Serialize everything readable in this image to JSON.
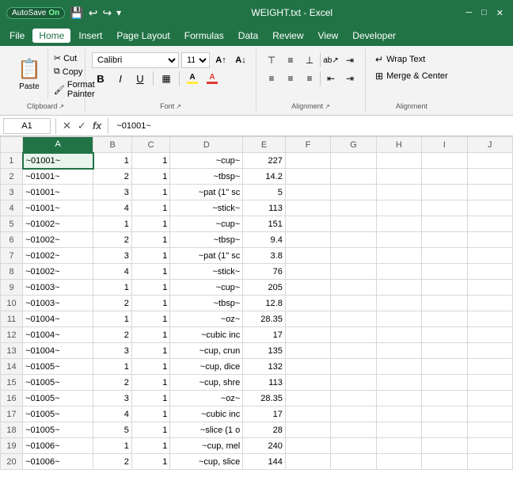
{
  "titleBar": {
    "autosave": "AutoSave",
    "autosave_state": "On",
    "title": "WEIGHT.txt  -  Excel"
  },
  "menuBar": {
    "items": [
      "File",
      "Home",
      "Insert",
      "Page Layout",
      "Formulas",
      "Data",
      "Review",
      "View",
      "Developer"
    ]
  },
  "ribbon": {
    "clipboard": {
      "label": "Clipboard",
      "paste": "Paste",
      "cut": "Cut",
      "copy": "Copy",
      "format_painter": "Format Painter"
    },
    "font": {
      "label": "Font",
      "name": "Calibri",
      "size": "11",
      "bold": "B",
      "italic": "I",
      "underline": "U",
      "border": "▦",
      "fill_color": "A",
      "font_color": "A"
    },
    "alignment": {
      "label": "Alignment"
    },
    "wrap": {
      "label": "Alignment",
      "wrap_text": "Wrap Text",
      "merge_center": "Merge & Center"
    }
  },
  "formulaBar": {
    "cell_ref": "A1",
    "formula": "~01001~"
  },
  "columns": {
    "headers": [
      "",
      "A",
      "B",
      "C",
      "D",
      "E",
      "F",
      "G",
      "H",
      "I",
      "J"
    ],
    "widths": [
      22,
      70,
      40,
      40,
      70,
      40,
      45,
      45,
      45,
      45,
      45
    ]
  },
  "rows": [
    {
      "num": 1,
      "A": "~01001~",
      "B": "1",
      "C": "1",
      "D": "~cup~",
      "E": "227"
    },
    {
      "num": 2,
      "A": "~01001~",
      "B": "2",
      "C": "1",
      "D": "~tbsp~",
      "E": "14.2"
    },
    {
      "num": 3,
      "A": "~01001~",
      "B": "3",
      "C": "1",
      "D": "~pat (1\" sc",
      "E": "5"
    },
    {
      "num": 4,
      "A": "~01001~",
      "B": "4",
      "C": "1",
      "D": "~stick~",
      "E": "113"
    },
    {
      "num": 5,
      "A": "~01002~",
      "B": "1",
      "C": "1",
      "D": "~cup~",
      "E": "151"
    },
    {
      "num": 6,
      "A": "~01002~",
      "B": "2",
      "C": "1",
      "D": "~tbsp~",
      "E": "9.4"
    },
    {
      "num": 7,
      "A": "~01002~",
      "B": "3",
      "C": "1",
      "D": "~pat (1\" sc",
      "E": "3.8"
    },
    {
      "num": 8,
      "A": "~01002~",
      "B": "4",
      "C": "1",
      "D": "~stick~",
      "E": "76"
    },
    {
      "num": 9,
      "A": "~01003~",
      "B": "1",
      "C": "1",
      "D": "~cup~",
      "E": "205"
    },
    {
      "num": 10,
      "A": "~01003~",
      "B": "2",
      "C": "1",
      "D": "~tbsp~",
      "E": "12.8"
    },
    {
      "num": 11,
      "A": "~01004~",
      "B": "1",
      "C": "1",
      "D": "~oz~",
      "E": "28.35"
    },
    {
      "num": 12,
      "A": "~01004~",
      "B": "2",
      "C": "1",
      "D": "~cubic inc",
      "E": "17"
    },
    {
      "num": 13,
      "A": "~01004~",
      "B": "3",
      "C": "1",
      "D": "~cup, crun",
      "E": "135"
    },
    {
      "num": 14,
      "A": "~01005~",
      "B": "1",
      "C": "1",
      "D": "~cup, dice",
      "E": "132"
    },
    {
      "num": 15,
      "A": "~01005~",
      "B": "2",
      "C": "1",
      "D": "~cup, shre",
      "E": "113"
    },
    {
      "num": 16,
      "A": "~01005~",
      "B": "3",
      "C": "1",
      "D": "~oz~",
      "E": "28.35"
    },
    {
      "num": 17,
      "A": "~01005~",
      "B": "4",
      "C": "1",
      "D": "~cubic inc",
      "E": "17"
    },
    {
      "num": 18,
      "A": "~01005~",
      "B": "5",
      "C": "1",
      "D": "~slice (1 o",
      "E": "28"
    },
    {
      "num": 19,
      "A": "~01006~",
      "B": "1",
      "C": "1",
      "D": "~cup, mel",
      "E": "240"
    },
    {
      "num": 20,
      "A": "~01006~",
      "B": "2",
      "C": "1",
      "D": "~cup, slice",
      "E": "144"
    }
  ]
}
